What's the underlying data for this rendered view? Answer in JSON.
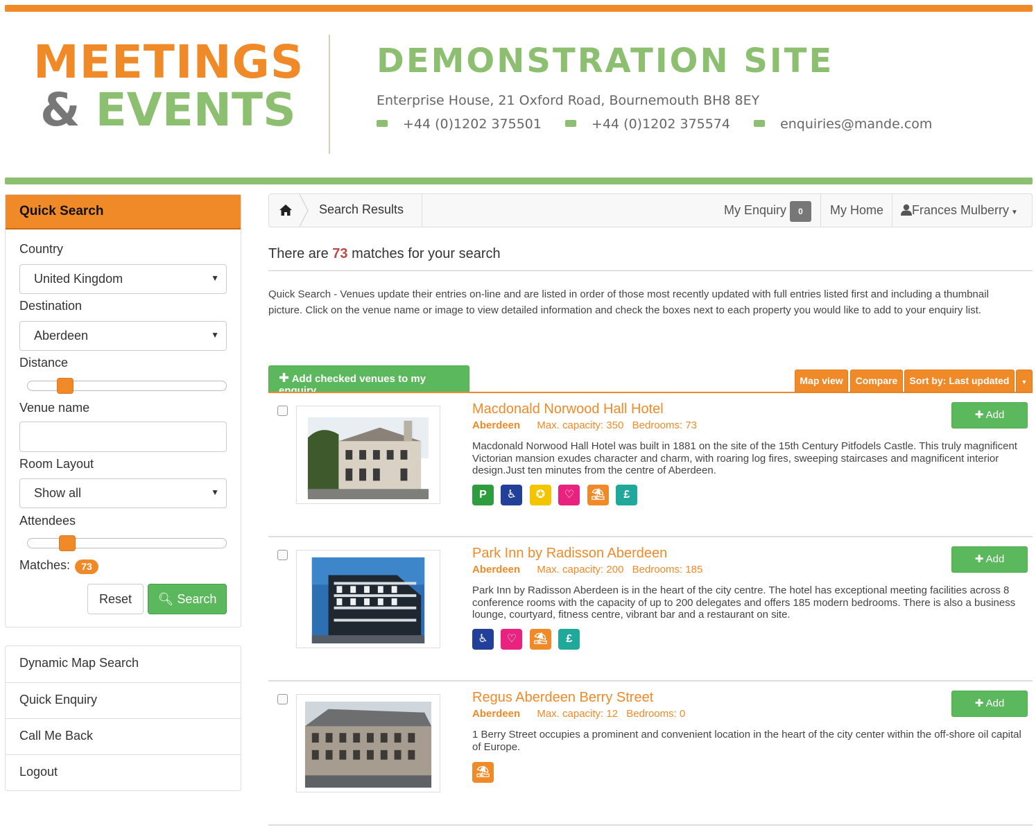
{
  "header": {
    "logo_line1": "MEETINGS",
    "logo_amp": "&",
    "logo_line2": "EVENTS",
    "site_title": "DEMONSTRATION SITE",
    "address": "Enterprise House, 21 Oxford Road, Bournemouth BH8 8EY",
    "phone": "+44 (0)1202 375501",
    "fax": "+44 (0)1202 375574",
    "email": "enquiries@mande.com"
  },
  "sidebar": {
    "title": "Quick Search",
    "country_label": "Country",
    "country_value": "United Kingdom",
    "destination_label": "Destination",
    "destination_value": "Aberdeen",
    "distance_label": "Distance",
    "distance_level": 0.16,
    "venue_name_label": "Venue name",
    "venue_name_value": "",
    "room_layout_label": "Room Layout",
    "room_layout_value": "Show all",
    "attendees_label": "Attendees",
    "attendees_level": 0.17,
    "matches_label": "Matches:",
    "matches_count": "73",
    "reset_label": "Reset",
    "search_label": "Search",
    "menu": [
      "Dynamic Map Search",
      "Quick Enquiry",
      "Call Me Back",
      "Logout"
    ]
  },
  "breadcrumb": {
    "current": "Search Results",
    "my_enquiry": "My Enquiry",
    "enquiry_count": "0",
    "my_home": "My Home",
    "user": "Frances Mulberry"
  },
  "results": {
    "prefix": "There are",
    "count": "73",
    "suffix": "matches for your search",
    "intro": "Quick Search - Venues update their entries on-line and are listed in order of those most recently updated with full entries listed first and including a thumbnail picture. Click on the venue name or image to view detailed information and check the boxes next to each property you would like to add to your enquiry list.",
    "add_checked": "Add checked venues to my enquiry",
    "map_view": "Map view",
    "compare": "Compare",
    "sort_by": "Sort by: Last updated",
    "add_label": "Add",
    "venues": [
      {
        "name": "Macdonald Norwood Hall Hotel",
        "location": "Aberdeen",
        "capacity_label": "Max. capacity:",
        "capacity": "350",
        "bedrooms_label": "Bedrooms:",
        "bedrooms": "73",
        "description": "Macdonald Norwood Hall Hotel was built in 1881 on the site of the 15th Century Pitfodels Castle. This truly magnificent Victorian mansion exudes character and charm, with roaring log fires, sweeping staircases and magnificent interior design.Just ten minutes from the centre of Aberdeen.",
        "facilities": [
          "parking-icon",
          "wheelchair-icon",
          "award-icon",
          "wedding-icon",
          "outdoor-icon",
          "currency-icon"
        ]
      },
      {
        "name": "Park Inn by Radisson Aberdeen",
        "location": "Aberdeen",
        "capacity_label": "Max. capacity:",
        "capacity": "200",
        "bedrooms_label": "Bedrooms:",
        "bedrooms": "185",
        "description": "Park Inn by Radisson Aberdeen is in the heart of the city centre. The hotel has exceptional meeting facilities across 8 conference rooms with the capacity of up to 200 delegates and offers 185 modern bedrooms. There is also a business lounge, courtyard, fitness centre, vibrant bar and a restaurant on site.",
        "facilities": [
          "wheelchair-icon",
          "wedding-icon",
          "outdoor-icon",
          "currency-icon"
        ]
      },
      {
        "name": "Regus Aberdeen Berry Street",
        "location": "Aberdeen",
        "capacity_label": "Max. capacity:",
        "capacity": "12",
        "bedrooms_label": "Bedrooms:",
        "bedrooms": "0",
        "description": "1 Berry Street occupies a prominent and convenient location in the heart of the city center within the off-shore oil capital of Europe.",
        "facilities": [
          "outdoor-icon"
        ]
      }
    ]
  },
  "colors": {
    "brand_orange": "#f08a28",
    "brand_green": "#8cbf6f",
    "button_green": "#5cb85c",
    "icon_green": "#2e9d3d",
    "icon_navy": "#22409a",
    "icon_yellow": "#f2c500",
    "icon_pink": "#e8227e",
    "icon_orange": "#f08a28",
    "icon_teal": "#20a99a"
  }
}
